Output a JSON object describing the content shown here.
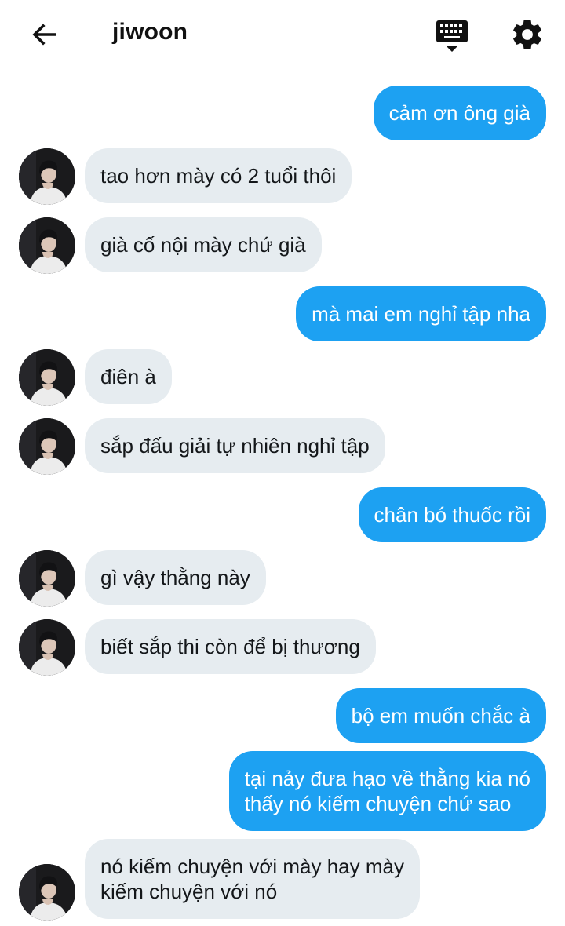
{
  "header": {
    "title": "jiwoon",
    "back_icon": "arrow-left-icon",
    "keyboard_icon": "keyboard-icon",
    "settings_icon": "gear-icon"
  },
  "colors": {
    "outgoing_bubble": "#1da1f2",
    "incoming_bubble": "#e6ecf0",
    "text_dark": "#14171a"
  },
  "messages": [
    {
      "direction": "out",
      "text": "cảm ơn ông già"
    },
    {
      "direction": "in",
      "text": "tao hơn mày có 2 tuổi thôi"
    },
    {
      "direction": "in",
      "text": "già cố nội mày chứ già"
    },
    {
      "direction": "out",
      "text": "mà mai em nghỉ tập nha"
    },
    {
      "direction": "in",
      "text": "điên à"
    },
    {
      "direction": "in",
      "text": "sắp đấu giải tự nhiên nghỉ tập"
    },
    {
      "direction": "out",
      "text": "chân bó thuốc rồi"
    },
    {
      "direction": "in",
      "text": "gì vậy thằng này"
    },
    {
      "direction": "in",
      "text": "biết sắp thi còn để bị thương"
    },
    {
      "direction": "out",
      "text": "bộ em muốn chắc à"
    },
    {
      "direction": "out",
      "line1": "tại nảy đưa hạo về thằng kia nó",
      "line2": "thấy nó kiếm chuyện chứ sao"
    },
    {
      "direction": "in",
      "line1": "nó kiếm chuyện với mày hay mày",
      "line2": "kiếm chuyện với nó"
    }
  ]
}
